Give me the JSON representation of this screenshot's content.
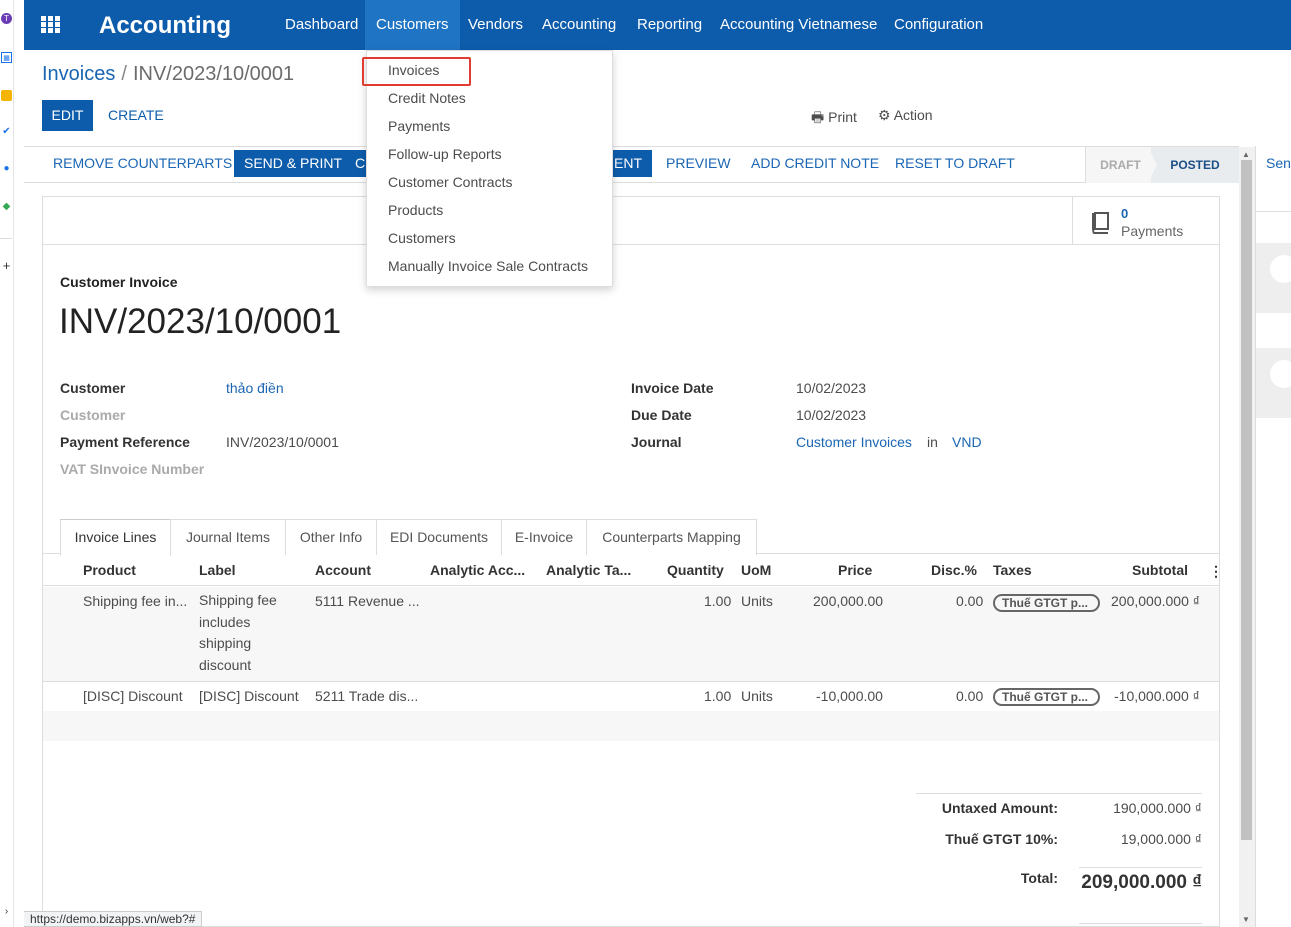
{
  "app": {
    "title": "Accounting"
  },
  "nav": {
    "items": [
      "Dashboard",
      "Customers",
      "Vendors",
      "Accounting",
      "Reporting",
      "Accounting Vietnamese",
      "Configuration"
    ]
  },
  "breadcrumb": {
    "parent": "Invoices",
    "separator": "/",
    "current": "INV/2023/10/0001"
  },
  "control": {
    "edit": "EDIT",
    "create": "CREATE",
    "print": "Print",
    "action": "Action"
  },
  "statusbar": {
    "buttons": [
      "REMOVE COUNTERPARTS",
      "SEND & PRINT",
      "C",
      "ENT",
      "PREVIEW",
      "ADD CREDIT NOTE",
      "RESET TO DRAFT"
    ],
    "stages": [
      "DRAFT",
      "POSTED"
    ],
    "active_stage": "POSTED"
  },
  "dropdown": {
    "items": [
      "Invoices",
      "Credit Notes",
      "Payments",
      "Follow-up Reports",
      "Customer Contracts",
      "Products",
      "Customers",
      "Manually Invoice Sale Contracts"
    ],
    "highlighted": "Invoices"
  },
  "smart_button": {
    "count": "0",
    "label": "Payments"
  },
  "form": {
    "doc_type": "Customer Invoice",
    "number": "INV/2023/10/0001",
    "left_fields": [
      {
        "label": "Customer",
        "value": "thảo điền"
      },
      {
        "label": "Customer",
        "value": ""
      },
      {
        "label": "Payment Reference",
        "value": "INV/2023/10/0001"
      },
      {
        "label": "VAT SInvoice Number",
        "value": ""
      }
    ],
    "right_fields": [
      {
        "label": "Invoice Date",
        "value": "10/02/2023"
      },
      {
        "label": "Due Date",
        "value": "10/02/2023"
      },
      {
        "label": "Journal",
        "value": "Customer Invoices",
        "in": "in",
        "currency": "VND"
      }
    ]
  },
  "tabs": [
    "Invoice Lines",
    "Journal Items",
    "Other Info",
    "EDI Documents",
    "E-Invoice",
    "Counterparts Mapping"
  ],
  "table": {
    "headers": [
      "Product",
      "Label",
      "Account",
      "Analytic Acc...",
      "Analytic Ta...",
      "Quantity",
      "UoM",
      "Price",
      "Disc.%",
      "Taxes",
      "Subtotal"
    ],
    "rows": [
      {
        "product": "Shipping fee in...",
        "label": "Shipping fee includes shipping discount",
        "account": "5111 Revenue ...",
        "quantity": "1.00",
        "uom": "Units",
        "price": "200,000.00",
        "disc": "0.00",
        "taxes": "Thuế GTGT p...",
        "subtotal": "200,000.000 ₫"
      },
      {
        "product": "[DISC] Discount",
        "label": "[DISC] Discount",
        "account": "5211 Trade dis...",
        "quantity": "1.00",
        "uom": "Units",
        "price": "-10,000.00",
        "disc": "0.00",
        "taxes": "Thuế GTGT p...",
        "subtotal": "-10,000.000 ₫"
      }
    ]
  },
  "totals": {
    "untaxed_label": "Untaxed Amount:",
    "untaxed_value": "190,000.000 ₫",
    "tax_label": "Thuế GTGT 10%:",
    "tax_value": "19,000.000 ₫",
    "total_label": "Total:",
    "total_value": "209,000.000 ₫"
  },
  "side": {
    "send": "Sen"
  },
  "browser": {
    "status_url": "https://demo.bizapps.vn/web?#"
  },
  "colors": {
    "nav_bg": "#0d5cab",
    "nav_active": "#1f74c4",
    "link": "#1a66b3",
    "highlight_border": "#e03c31"
  }
}
